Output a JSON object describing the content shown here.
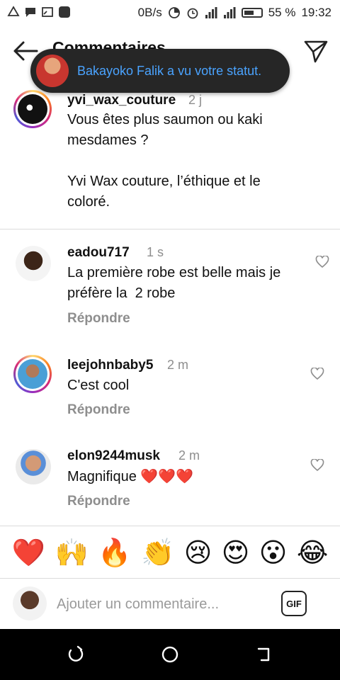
{
  "status_bar": {
    "network": "0B/s",
    "battery": "55 %",
    "time": "19:32"
  },
  "header": {
    "title": "Commentaires"
  },
  "toast": {
    "text": "Bakayoko Falik a vu votre statut."
  },
  "comments": [
    {
      "username": "yvi_wax_couture",
      "time": "2 j",
      "lines": [
        "Vous êtes plus saumon ou kaki",
        "mesdames ?",
        "",
        "Yvi Wax couture, l’éthique et le",
        "coloré."
      ],
      "is_caption": true
    },
    {
      "username": "eadou717",
      "time": "1 s",
      "lines": [
        "La première robe est belle mais je",
        "préfère la  2 robe"
      ],
      "reply": "Répondre"
    },
    {
      "username": "leejohnbaby5",
      "time": "2 m",
      "lines": [
        "C'est cool"
      ],
      "reply": "Répondre"
    },
    {
      "username": "elon9244musk",
      "time": "2 m",
      "lines": [
        "Magnifique ❤️❤️❤️"
      ],
      "reply": "Répondre"
    }
  ],
  "emoji_bar": [
    "❤️",
    "🙌",
    "🔥",
    "👏",
    "😢",
    "😍",
    "😮",
    "😂"
  ],
  "input": {
    "placeholder": "Ajouter un commentaire...",
    "gif_label": "GIF"
  },
  "colors": {
    "toast_bg": "#262626",
    "toast_text": "#4aa3ff",
    "secondary_text": "#8e8e8e"
  }
}
